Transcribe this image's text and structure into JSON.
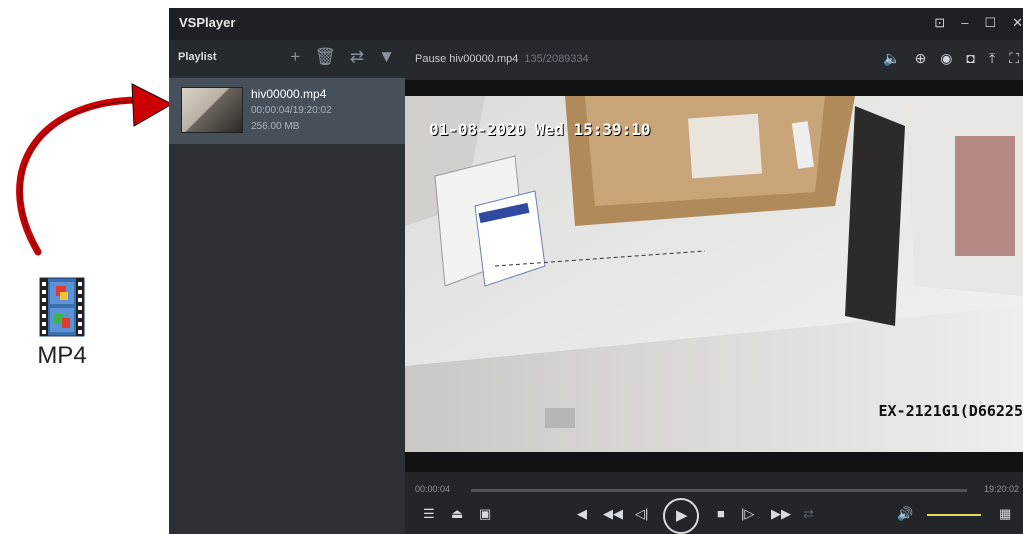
{
  "desktop": {
    "file_icon": {
      "icon": "mp4-file-icon",
      "label": "MP4"
    },
    "arrow_color": "#cc0000"
  },
  "window": {
    "title": "VSPlayer",
    "controls": [
      "⊡",
      "–",
      "☐",
      "✕"
    ]
  },
  "playlist": {
    "title": "Playlist",
    "tools": [
      {
        "icon": "add-icon",
        "glyph": "+"
      },
      {
        "icon": "delete-icon",
        "glyph": "🗑"
      },
      {
        "icon": "repeat-icon",
        "glyph": "⇄"
      },
      {
        "icon": "filter-icon",
        "glyph": "▼"
      }
    ],
    "items": [
      {
        "name": "hiv00000.mp4",
        "time": "00:00:04/19:20:02",
        "size": "256.00 MB",
        "selected": true
      }
    ]
  },
  "status": {
    "text": "Pause hiv00000.mp4",
    "frame": "135/2089334"
  },
  "toolbar": [
    {
      "icon": "audio-icon",
      "glyph": "🔈"
    },
    {
      "icon": "zoom-icon",
      "glyph": "⊕"
    },
    {
      "icon": "snapshot-icon",
      "glyph": "◉"
    },
    {
      "icon": "multi-snapshot-icon",
      "glyph": "◘"
    },
    {
      "icon": "pin-on-top-icon",
      "glyph": "⤒"
    },
    {
      "icon": "fullscreen-icon",
      "glyph": "⛶"
    }
  ],
  "video": {
    "osd_datetime": "01-08-2020 Wed 15:39:10",
    "osd_camera": "EX-2121G1(D66225"
  },
  "playback": {
    "current_time": "00:00:04",
    "total_time": "19:20:02",
    "progress_fraction": 0.0,
    "volume_fraction": 1.0,
    "buttons": [
      {
        "icon": "playlist-toggle-icon",
        "glyph": "☰"
      },
      {
        "icon": "open-file-icon",
        "glyph": "⏏"
      },
      {
        "icon": "toolbox-icon",
        "glyph": "▣"
      },
      {
        "icon": "stop-previous-icon",
        "glyph": "◀"
      },
      {
        "icon": "slow-icon",
        "glyph": "◀◀"
      },
      {
        "icon": "step-back-icon",
        "glyph": "◁|"
      },
      {
        "icon": "play-icon",
        "glyph": "▶"
      },
      {
        "icon": "stop-icon",
        "glyph": "■"
      },
      {
        "icon": "step-forward-icon",
        "glyph": "|▷"
      },
      {
        "icon": "fast-icon",
        "glyph": "▶▶"
      },
      {
        "icon": "sync-icon",
        "glyph": "⇄"
      },
      {
        "icon": "volume-icon",
        "glyph": "🔊"
      },
      {
        "icon": "layout-grid-icon",
        "glyph": "▦"
      }
    ]
  }
}
